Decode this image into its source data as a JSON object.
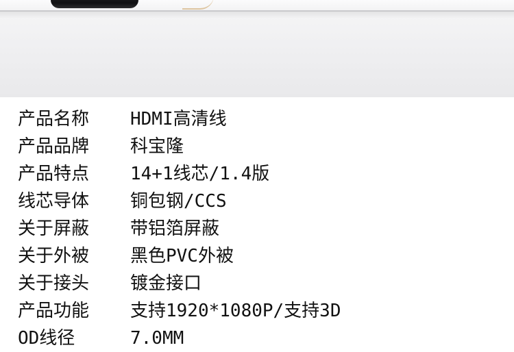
{
  "specs": [
    {
      "label": "产品名称",
      "value": "HDMI高清线"
    },
    {
      "label": "产品品牌",
      "value": "科宝隆"
    },
    {
      "label": "产品特点",
      "value": "14+1线芯/1.4版"
    },
    {
      "label": "线芯导体",
      "value": "铜包钢/CCS"
    },
    {
      "label": "关于屏蔽",
      "value": "带铝箔屏蔽"
    },
    {
      "label": "关于外被",
      "value": "黑色PVC外被"
    },
    {
      "label": "关于接头",
      "value": "镀金接口"
    },
    {
      "label": "产品功能",
      "value": "支持1920*1080P/支持3D"
    },
    {
      "label": "OD线径",
      "value": "7.0MM"
    }
  ]
}
